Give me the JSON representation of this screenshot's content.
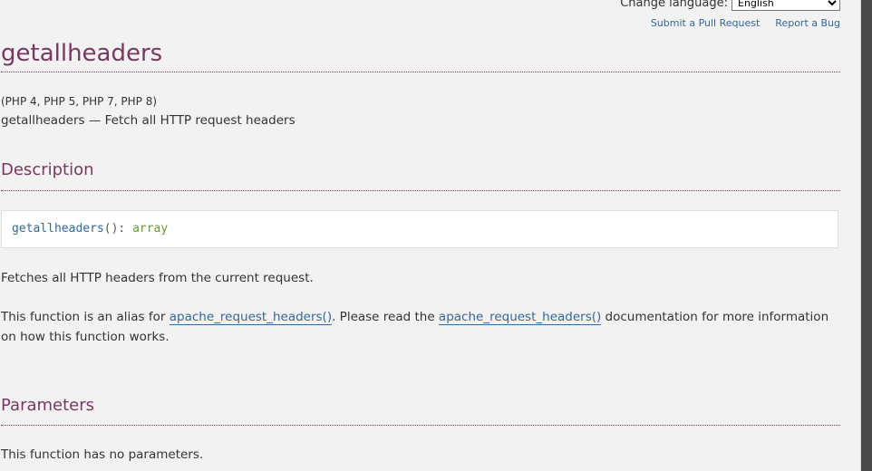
{
  "language_bar": {
    "label": "Change language:",
    "selected_language": "English"
  },
  "edit_links": {
    "pull_request": "Submit a Pull Request",
    "report_bug": "Report a Bug"
  },
  "refentry": {
    "title": "getallheaders",
    "versions": "(PHP 4, PHP 5, PHP 7, PHP 8)",
    "purpose": "getallheaders — Fetch all HTTP request headers"
  },
  "description": {
    "heading": "Description",
    "synopsis": {
      "method_name": "getallheaders",
      "parens": "(): ",
      "return_type": "array"
    },
    "para1": "Fetches all HTTP headers from the current request.",
    "para2_part1": "This function is an alias for ",
    "para2_link1": "apache_request_headers()",
    "para2_part2": ". Please read the ",
    "para2_link2": "apache_request_headers()",
    "para2_part3": " documentation for more information on how this function works."
  },
  "parameters": {
    "heading": "Parameters",
    "text": "This function has no parameters."
  },
  "colors": {
    "accent": "#793862",
    "link": "#336699",
    "type": "#669933",
    "background": "#f2f2f2"
  }
}
